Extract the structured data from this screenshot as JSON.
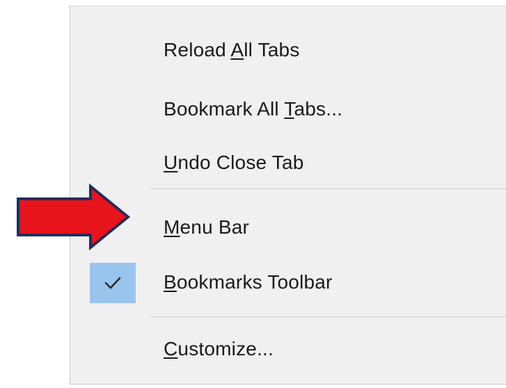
{
  "menu": {
    "items": [
      {
        "pre": "Reload ",
        "mnemonic": "A",
        "post": "ll Tabs",
        "checked": false
      },
      {
        "pre": "Bookmark All ",
        "mnemonic": "T",
        "post": "abs...",
        "checked": false
      },
      {
        "pre": "",
        "mnemonic": "U",
        "post": "ndo Close Tab",
        "checked": false
      },
      {
        "pre": "",
        "mnemonic": "M",
        "post": "enu Bar",
        "checked": false
      },
      {
        "pre": "",
        "mnemonic": "B",
        "post": "ookmarks Toolbar",
        "checked": true
      },
      {
        "pre": "",
        "mnemonic": "C",
        "post": "ustomize...",
        "checked": false
      }
    ]
  },
  "annotation": {
    "arrow_color": "#e8141c",
    "arrow_outline_color": "#1f2f5c",
    "points_to": "Menu Bar"
  },
  "colors": {
    "menu_background": "#f0f0f0",
    "check_highlight": "#99c4ee",
    "separator": "#d0d0d0"
  }
}
